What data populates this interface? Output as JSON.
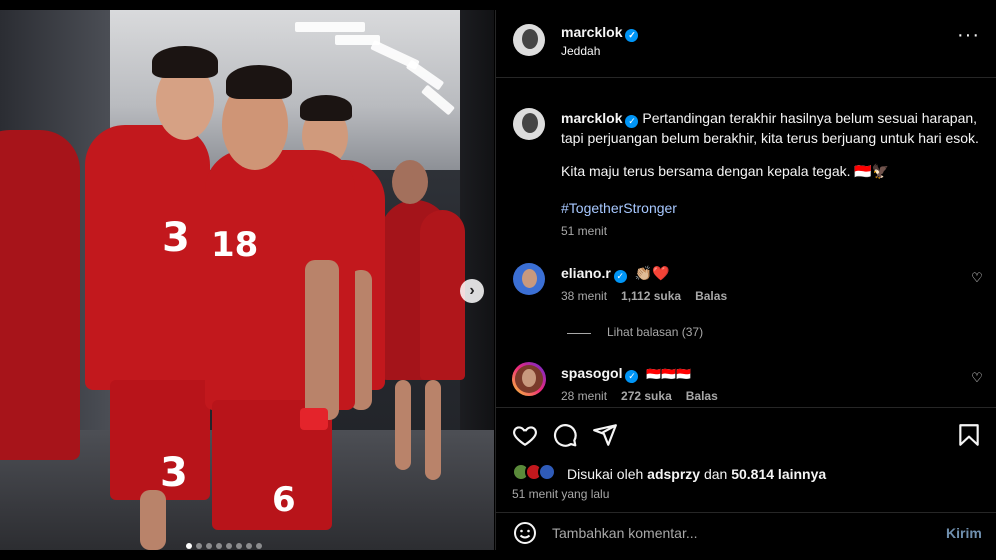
{
  "post": {
    "author": "marcklok",
    "location": "Jeddah",
    "more_icon": "more-horizontal-icon"
  },
  "caption": {
    "author": "marcklok",
    "line1": "Pertandingan terakhir hasilnya belum sesuai harapan,",
    "line2": "tapi perjuangan belum berakhir, kita terus berjuang untuk hari esok.",
    "line3": "Kita maju terus bersama dengan kepala tegak. 🇮🇩🦅",
    "hashtag": "#TogetherStronger",
    "time": "51 menit"
  },
  "comments": [
    {
      "user": "eliano.r",
      "text": "👏🏼❤️",
      "time": "38 menit",
      "likes": "1,112 suka",
      "reply": "Balas"
    },
    {
      "user": "spasogol",
      "text": "🇮🇩🇮🇩🇮🇩",
      "time": "28 menit",
      "likes": "272 suka",
      "reply": "Balas"
    }
  ],
  "view_replies": "Lihat balasan (37)",
  "likes_summary": {
    "prefix": "Disukai oleh",
    "user": "adsprzy",
    "connector": "dan",
    "count": "50.814 lainnya"
  },
  "posted_ago": "51 menit yang lalu",
  "comment_input": {
    "placeholder": "Tambahkan komentar...",
    "submit": "Kirim"
  },
  "carousel": {
    "next_icon": "chevron-right-icon",
    "total_slides": 8,
    "active_index": 0
  },
  "colors": {
    "background": "#000000",
    "text": "#f5f5f5",
    "muted": "#a8a8a8",
    "link": "#e0f1ff",
    "verified": "#0095f6",
    "jersey": "#c2181d"
  }
}
